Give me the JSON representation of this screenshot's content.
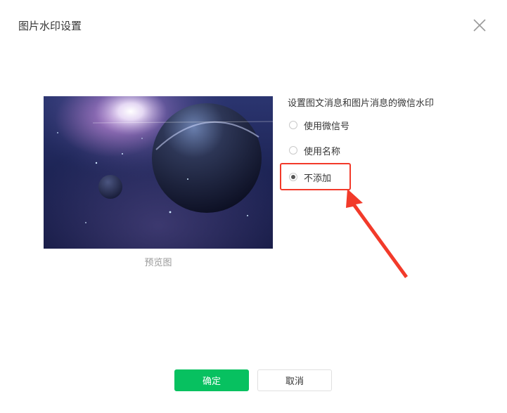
{
  "dialog": {
    "title": "图片水印设置"
  },
  "preview": {
    "caption": "预览图"
  },
  "watermark": {
    "heading": "设置图文消息和图片消息的微信水印",
    "options": [
      {
        "label": "使用微信号",
        "checked": false
      },
      {
        "label": "使用名称",
        "checked": false
      },
      {
        "label": "不添加",
        "checked": true
      }
    ]
  },
  "footer": {
    "confirm_label": "确定",
    "cancel_label": "取消"
  },
  "colors": {
    "primary_green": "#07c160",
    "annotation_red": "#f23a2a"
  },
  "icons": {
    "close": "close-icon",
    "annotation": "arrow-icon"
  }
}
